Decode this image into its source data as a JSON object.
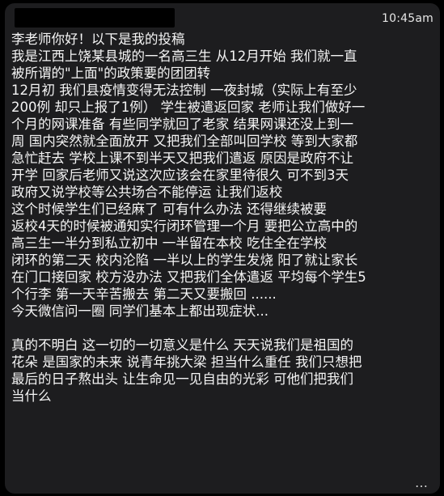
{
  "message": {
    "timestamp": "10:45am",
    "lines": [
      "李老师你好！以下是我的投稿",
      "我是江西上饶某县城的一名高三生 从12月开始 我们就一直",
      "被所谓的\"上面\"的政策要的团团转",
      "12月初  我们县疫情变得无法控制 一夜封城（实际上有至少",
      "200例 却只上报了1例）  学生被遣返回家 老师让我们做好一",
      "个月的网课准备 有些同学就回了老家 结果网课还没上到一",
      "周 国内突然就全面放开 又把我们全部叫回学校 等到大家都",
      "急忙赶去 学校上课不到半天又把我们遣返 原因是政府不让",
      "开学 回家后老师又说这次应该会在家里待很久  可不到3天",
      "政府又说学校等公共场合不能停运 让我们返校",
      "这个时候学生们已经麻了 可有什么办法 还得继续被要",
      "返校4天的时候被通知实行闭环管理一个月 要把公立高中的",
      "高三生一半分到私立初中 一半留在本校  吃住全在学校",
      "闭环的第二天 校内沦陷 一半以上的学生发烧 阳了就让家长",
      "在门口接回家 校方没办法 又把我们全体遣返 平均每个学生5",
      "个行李 第一天辛苦搬去 第二天又要搬回 ......",
      "今天微信问一圈 同学们基本上都出现症状...",
      "",
      "真的不明白 这一切的一切意义是什么  天天说我们是祖国的",
      "花朵 是国家的未来 说青年挑大梁 担当什么重任  我们只想把",
      "最后的日子熬出头 让生命见一见自由的光彩 可他们把我们",
      "当什么"
    ],
    "more_icon": "more-horizontal-icon",
    "more_glyph": "…"
  },
  "colors": {
    "page_background": "#000000",
    "bubble_background": "#1d1d1f",
    "text": "#f5f5f5"
  }
}
